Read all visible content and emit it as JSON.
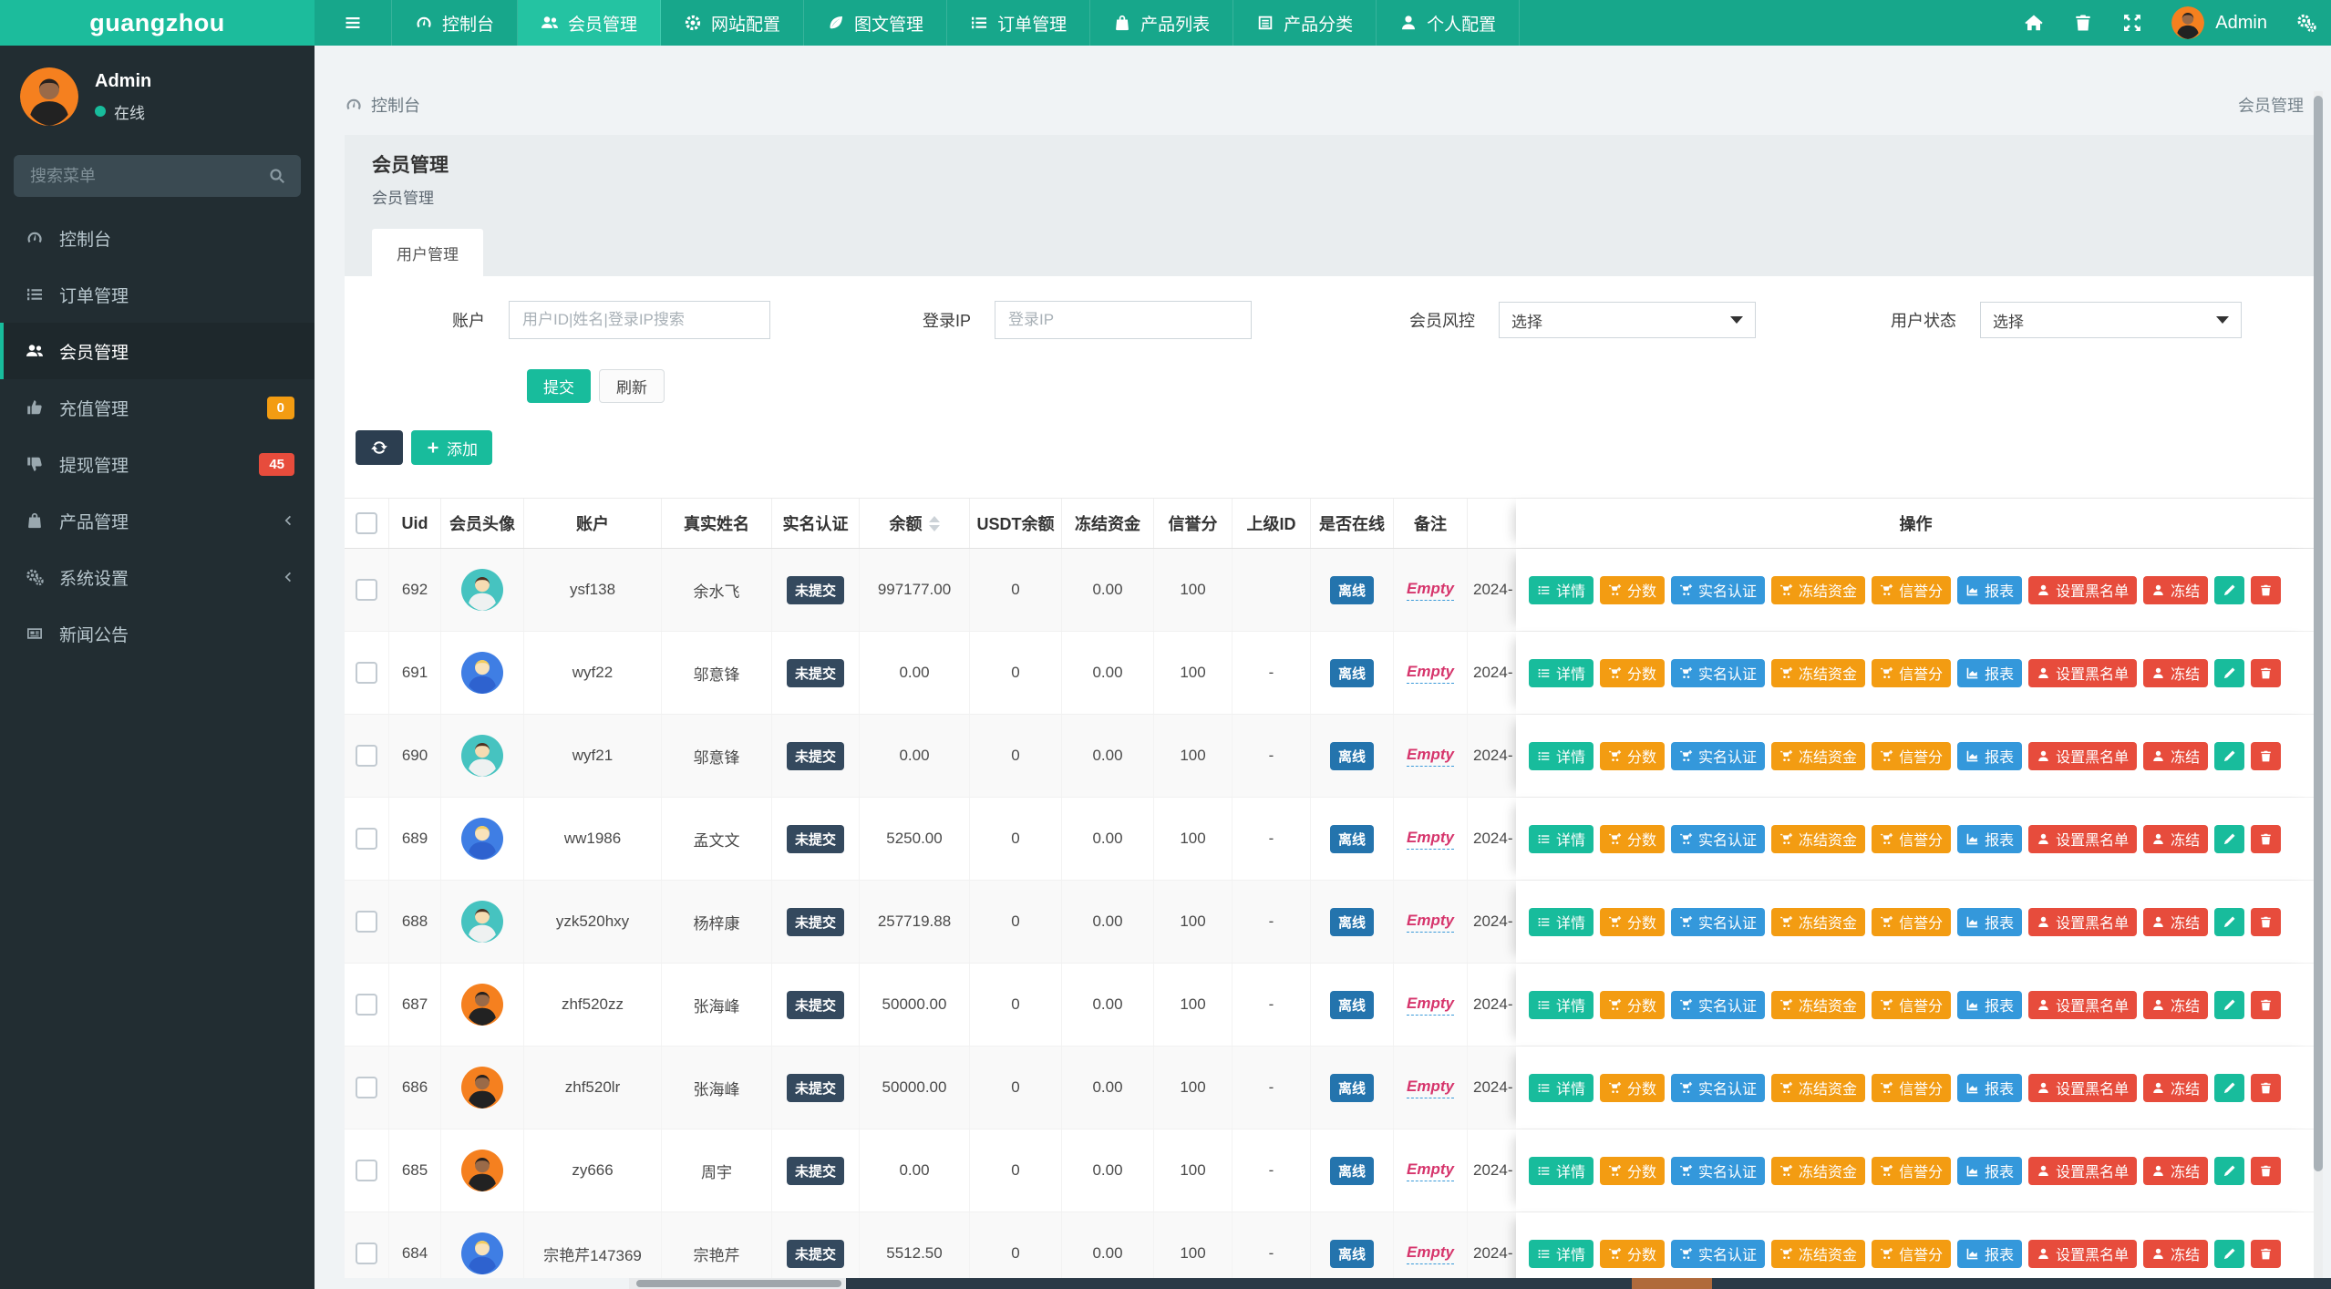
{
  "colors": {
    "accent": "#18bc9c",
    "navbar_bg": "#17a78b",
    "logo_bg": "#1cbc9c",
    "nav_active": "#24c3a2",
    "sidebar_bg": "#222d32",
    "orange": "#f39c12",
    "red": "#e74c3c",
    "blue": "#3498db",
    "dark": "#2c3e50",
    "online_badge": "#2474ad",
    "empty_text": "#d6356c"
  },
  "navbar": {
    "logo": "guangzhou",
    "user": "Admin",
    "items": [
      {
        "label": "控制台",
        "icon": "dashboard-icon"
      },
      {
        "label": "会员管理",
        "icon": "users-icon",
        "active": true
      },
      {
        "label": "网站配置",
        "icon": "gear-icon"
      },
      {
        "label": "图文管理",
        "icon": "leaf-icon"
      },
      {
        "label": "订单管理",
        "icon": "list-ol-icon"
      },
      {
        "label": "产品列表",
        "icon": "bag-icon"
      },
      {
        "label": "产品分类",
        "icon": "grid-icon"
      },
      {
        "label": "个人配置",
        "icon": "user-icon"
      }
    ]
  },
  "sidebar": {
    "user": "Admin",
    "status": "在线",
    "search_placeholder": "搜索菜单",
    "items": [
      {
        "label": "控制台",
        "icon": "dashboard-icon"
      },
      {
        "label": "订单管理",
        "icon": "list-ol-icon"
      },
      {
        "label": "会员管理",
        "icon": "users-icon",
        "active": true
      },
      {
        "label": "充值管理",
        "icon": "thumb-up-icon",
        "badge": "0",
        "badge_color": "#f39c12"
      },
      {
        "label": "提现管理",
        "icon": "thumb-down-icon",
        "badge": "45",
        "badge_color": "#e74c3c"
      },
      {
        "label": "产品管理",
        "icon": "bag-icon",
        "chevron": true
      },
      {
        "label": "系统设置",
        "icon": "gears-icon",
        "chevron": true
      },
      {
        "label": "新闻公告",
        "icon": "newspaper-icon"
      }
    ]
  },
  "breadcrumb": {
    "left": "控制台",
    "right": "会员管理"
  },
  "page": {
    "title": "会员管理",
    "subtitle": "会员管理",
    "tab": "用户管理"
  },
  "filters": {
    "account_label": "账户",
    "account_placeholder": "用户ID|姓名|登录IP搜索",
    "ip_label": "登录IP",
    "ip_placeholder": "登录IP",
    "risk_label": "会员风控",
    "risk_value": "选择",
    "status_label": "用户状态",
    "status_value": "选择",
    "submit": "提交",
    "refresh": "刷新",
    "add": "添加"
  },
  "table": {
    "headers": [
      "Uid",
      "会员头像",
      "账户",
      "真实姓名",
      "实名认证",
      "余额",
      "USDT余额",
      "冻结资金",
      "信誉分",
      "上级ID",
      "是否在线",
      "备注",
      "操作"
    ],
    "sort_column": "余额",
    "action_buttons": [
      {
        "label": "详情",
        "icon": "list-icon",
        "color": "#18bc9c",
        "name": "detail-button"
      },
      {
        "label": "分数",
        "icon": "cart-plus-icon",
        "color": "#f39c12",
        "name": "score-button"
      },
      {
        "label": "实名认证",
        "icon": "cart-plus-icon",
        "color": "#3498db",
        "name": "verify-button"
      },
      {
        "label": "冻结资金",
        "icon": "cart-plus-icon",
        "color": "#f39c12",
        "name": "freeze-funds-button"
      },
      {
        "label": "信誉分",
        "icon": "cart-plus-icon",
        "color": "#f39c12",
        "name": "credit-button"
      },
      {
        "label": "报表",
        "icon": "chart-icon",
        "color": "#3498db",
        "name": "report-button"
      },
      {
        "label": "设置黑名单",
        "icon": "user-icon",
        "color": "#e74c3c",
        "name": "blacklist-button"
      },
      {
        "label": "冻结",
        "icon": "user-icon",
        "color": "#e74c3c",
        "name": "freeze-button"
      },
      {
        "label": "",
        "icon": "pencil-icon",
        "color": "#18bc9c",
        "name": "edit-button"
      },
      {
        "label": "",
        "icon": "trash-icon",
        "color": "#e74c3c",
        "name": "delete-button"
      }
    ],
    "rows": [
      {
        "uid": "692",
        "avatar": "teal",
        "account": "ysf138",
        "name": "余水飞",
        "verify": "未提交",
        "balance": "997177.00",
        "usdt": "0",
        "frozen": "0.00",
        "credit": "100",
        "parent": "",
        "online": "离线",
        "remark": "Empty",
        "date": "2024-"
      },
      {
        "uid": "691",
        "avatar": "blue",
        "account": "wyf22",
        "name": "邬意锋",
        "verify": "未提交",
        "balance": "0.00",
        "usdt": "0",
        "frozen": "0.00",
        "credit": "100",
        "parent": "-",
        "online": "离线",
        "remark": "Empty",
        "date": "2024-"
      },
      {
        "uid": "690",
        "avatar": "teal",
        "account": "wyf21",
        "name": "邬意锋",
        "verify": "未提交",
        "balance": "0.00",
        "usdt": "0",
        "frozen": "0.00",
        "credit": "100",
        "parent": "-",
        "online": "离线",
        "remark": "Empty",
        "date": "2024-"
      },
      {
        "uid": "689",
        "avatar": "blue",
        "account": "ww1986",
        "name": "孟文文",
        "verify": "未提交",
        "balance": "5250.00",
        "usdt": "0",
        "frozen": "0.00",
        "credit": "100",
        "parent": "-",
        "online": "离线",
        "remark": "Empty",
        "date": "2024-"
      },
      {
        "uid": "688",
        "avatar": "teal",
        "account": "yzk520hxy",
        "name": "杨梓康",
        "verify": "未提交",
        "balance": "257719.88",
        "usdt": "0",
        "frozen": "0.00",
        "credit": "100",
        "parent": "-",
        "online": "离线",
        "remark": "Empty",
        "date": "2024-"
      },
      {
        "uid": "687",
        "avatar": "orange",
        "account": "zhf520zz",
        "name": "张海峰",
        "verify": "未提交",
        "balance": "50000.00",
        "usdt": "0",
        "frozen": "0.00",
        "credit": "100",
        "parent": "-",
        "online": "离线",
        "remark": "Empty",
        "date": "2024-"
      },
      {
        "uid": "686",
        "avatar": "orange",
        "account": "zhf520lr",
        "name": "张海峰",
        "verify": "未提交",
        "balance": "50000.00",
        "usdt": "0",
        "frozen": "0.00",
        "credit": "100",
        "parent": "-",
        "online": "离线",
        "remark": "Empty",
        "date": "2024-"
      },
      {
        "uid": "685",
        "avatar": "orange",
        "account": "zy666",
        "name": "周宇",
        "verify": "未提交",
        "balance": "0.00",
        "usdt": "0",
        "frozen": "0.00",
        "credit": "100",
        "parent": "-",
        "online": "离线",
        "remark": "Empty",
        "date": "2024-"
      },
      {
        "uid": "684",
        "avatar": "blue",
        "account": "宗艳芹147369",
        "name": "宗艳芹",
        "verify": "未提交",
        "balance": "5512.50",
        "usdt": "0",
        "frozen": "0.00",
        "credit": "100",
        "parent": "-",
        "online": "离线",
        "remark": "Empty",
        "date": "2024-"
      }
    ]
  }
}
